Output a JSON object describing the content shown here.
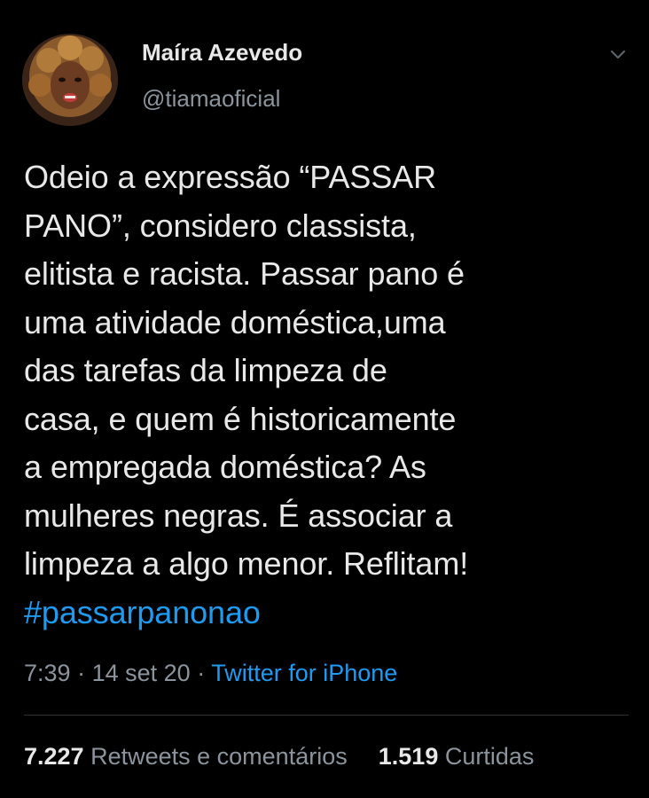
{
  "tweet": {
    "author": {
      "display_name": "Maíra Azevedo",
      "handle": "@tiamaoficial"
    },
    "text": "Odeio a expressão “PASSAR\nPANO”,  considero classista,\nelitista e racista. Passar pano é\numa atividade doméstica,uma\ndas tarefas da limpeza de\ncasa, e quem é historicamente\na empregada doméstica? As\nmulheres negras. É associar a\nlimpeza a algo menor. Reflitam!",
    "hashtag": "#passarpanonao",
    "time": "7:39",
    "separator": "·",
    "date": "14 set 20",
    "source": "Twitter for iPhone",
    "stats": {
      "retweets_count": "7.227",
      "retweets_label": "Retweets e comentários",
      "likes_count": "1.519",
      "likes_label": "Curtidas"
    }
  },
  "colors": {
    "background": "#000000",
    "accent": "#1d9bf0",
    "secondary_text": "#8b949c",
    "primary_text": "#e8e8e8"
  },
  "icons": {
    "menu": "chevron-down-icon"
  }
}
